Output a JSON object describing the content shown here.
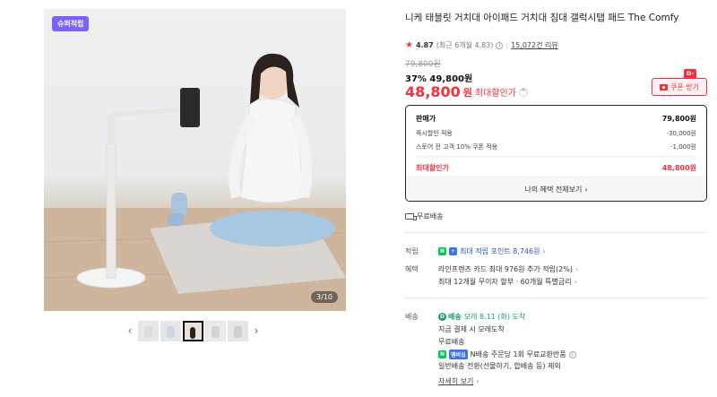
{
  "gallery": {
    "badge": "슈퍼적립",
    "counter": "3/10",
    "prev_icon": "‹",
    "next_icon": "›"
  },
  "product": {
    "title": "니케 태블릿 거치대 아이패드 거치대 침대 갤럭시탭 패드 The Comfy",
    "rating_score": "4.87",
    "rating_recent": "(최근 6개월 4.83)",
    "review_count": "15,072건 리뷰",
    "original_price": "79,800원",
    "discount_line": "37% 49,800원",
    "max_price_value": "48,800",
    "max_price_unit": "원",
    "max_price_label": "최대할인가",
    "coupon_dday": "D-4",
    "coupon_label": "쿠폰 받기"
  },
  "price_box": {
    "head_label": "판매가",
    "head_value": "79,800원",
    "rows": [
      {
        "label": "즉시할인 적용",
        "value": "-30,000원"
      },
      {
        "label": "스토어 전 고객 10% 쿠폰 적용",
        "value": "-1,000원"
      }
    ],
    "max_label": "최대할인가",
    "max_value": "48,800원",
    "footer_label": "나의 혜택 전체보기",
    "footer_arrow": "›"
  },
  "shipping_free": "무료배송",
  "points": {
    "label": "적립",
    "badge_n": "N",
    "badge_plus": "+",
    "text": "최대 적립 포인트 8,746원",
    "arrow": "›"
  },
  "benefit": {
    "label": "혜택",
    "line1": "라인프렌즈 카드 최대 976원 추가 적립(2%)",
    "line2": "최대 12개월 무이자 할부 · 60개월 특별금리",
    "arrow": "›"
  },
  "delivery": {
    "label": "배송",
    "tday_badge": "D",
    "tday_text": "배송",
    "date_text": "모레 8.11 (화) 도착",
    "line2": "지금 결제 시 모레도착",
    "line3": "무료배송",
    "line4_badge_n": "N",
    "line4_badge_pay": "멤버십",
    "line4_text": "N배송 주문당 1회 무료교환반품",
    "line5": "일반배송 전환(선물하기, 합배송 등) 제외",
    "more": "자세히 보기",
    "more_arrow": "›"
  }
}
